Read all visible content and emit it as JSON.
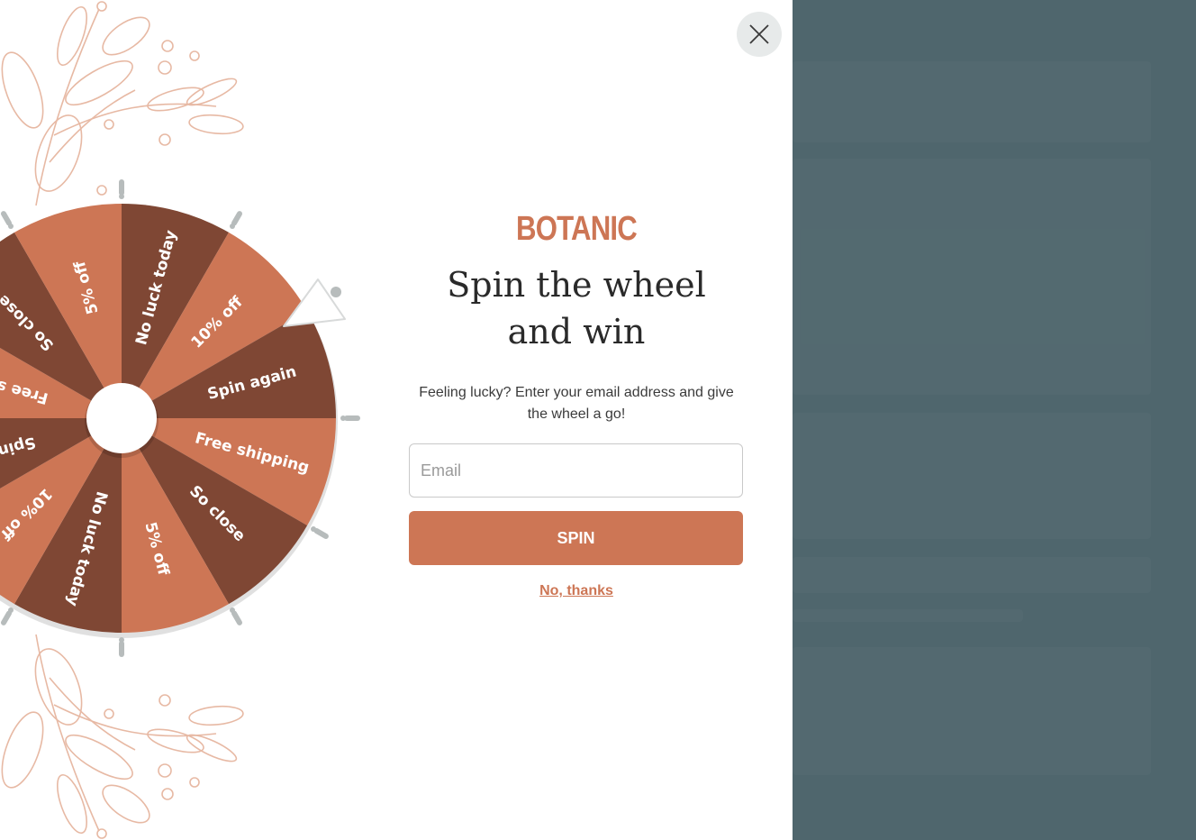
{
  "modal": {
    "close_icon": "close-icon",
    "brand": "BOTANIC",
    "title_line1": "Spin the wheel",
    "title_line2": "and win",
    "subtitle_line1": "Feeling lucky? Enter your email address and give",
    "subtitle_line2": "the wheel a go!",
    "email_placeholder": "Email",
    "spin_label": "SPIN",
    "no_thanks_label": "No, thanks"
  },
  "wheel": {
    "segments": [
      "No luck today",
      "10% off",
      "Spin again",
      "Free shipping",
      "So close",
      "5% off",
      "No luck today",
      "10% off",
      "Spin again",
      "Free shipping",
      "So close",
      "5% off"
    ]
  },
  "colors": {
    "accent": "#cd7655",
    "segment_light": "#cd7655",
    "segment_dark": "#7f4734",
    "backdrop": "#4f666d"
  }
}
